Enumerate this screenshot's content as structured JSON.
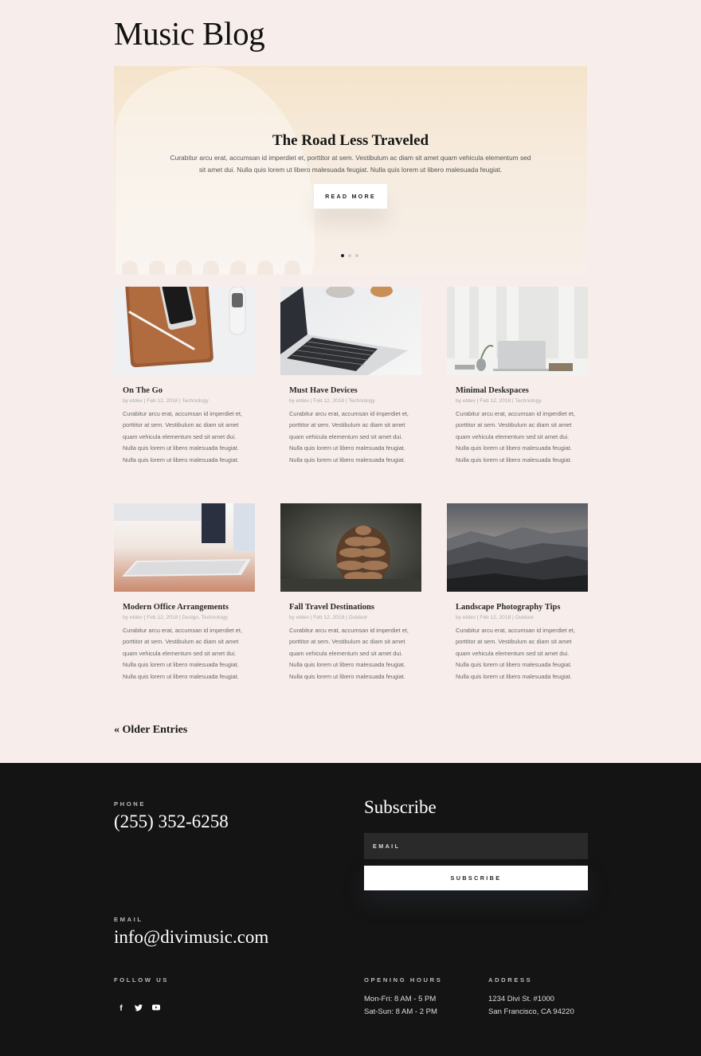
{
  "page": {
    "title": "Music Blog"
  },
  "hero": {
    "title": "The Road Less Traveled",
    "text": "Curabitur arcu erat, accumsan id imperdiet et, porttitor at sem. Vestibulum ac diam sit amet quam vehicula elementum sed sit amet dui. Nulla quis lorem ut libero malesuada feugiat. Nulla quis lorem ut libero malesuada feugiat.",
    "button_label": "READ MORE",
    "slides": 3,
    "active_slide": 1
  },
  "posts": [
    {
      "title": "On The Go",
      "meta": "by etdev | Feb 12, 2018 | Technology",
      "excerpt": "Curabitur arcu erat, accumsan id imperdiet et, porttitor at sem. Vestibulum ac diam sit amet quam vehicula elementum sed sit amet dui. Nulla quis lorem ut libero malesuada feugiat. Nulla quis lorem ut libero malesuada feugiat.",
      "image": "tablet-phone-pen"
    },
    {
      "title": "Must Have Devices",
      "meta": "by etdev | Feb 12, 2018 | Technology",
      "excerpt": "Curabitur arcu erat, accumsan id imperdiet et, porttitor at sem. Vestibulum ac diam sit amet quam vehicula elementum sed sit amet dui. Nulla quis lorem ut libero malesuada feugiat. Nulla quis lorem ut libero malesuada feugiat.",
      "image": "laptop-keyboard"
    },
    {
      "title": "Minimal Deskspaces",
      "meta": "by etdev | Feb 12, 2018 | Technology",
      "excerpt": "Curabitur arcu erat, accumsan id imperdiet et, porttitor at sem. Vestibulum ac diam sit amet quam vehicula elementum sed sit amet dui. Nulla quis lorem ut libero malesuada feugiat. Nulla quis lorem ut libero malesuada feugiat.",
      "image": "desk-laptop"
    },
    {
      "title": "Modern Office Arrangements",
      "meta": "by etdev | Feb 12, 2018 | Design, Technology",
      "excerpt": "Curabitur arcu erat, accumsan id imperdiet et, porttitor at sem. Vestibulum ac diam sit amet quam vehicula elementum sed sit amet dui. Nulla quis lorem ut libero malesuada feugiat. Nulla quis lorem ut libero malesuada feugiat.",
      "image": "keyboard"
    },
    {
      "title": "Fall Travel Destinations",
      "meta": "by etdev | Feb 12, 2018 | Outdoor",
      "excerpt": "Curabitur arcu erat, accumsan id imperdiet et, porttitor at sem. Vestibulum ac diam sit amet quam vehicula elementum sed sit amet dui. Nulla quis lorem ut libero malesuada feugiat. Nulla quis lorem ut libero malesuada feugiat.",
      "image": "pinecone"
    },
    {
      "title": "Landscape Photography Tips",
      "meta": "by etdev | Feb 12, 2018 | Outdoor",
      "excerpt": "Curabitur arcu erat, accumsan id imperdiet et, porttitor at sem. Vestibulum ac diam sit amet quam vehicula elementum sed sit amet dui. Nulla quis lorem ut libero malesuada feugiat. Nulla quis lorem ut libero malesuada feugiat.",
      "image": "mountains"
    }
  ],
  "pagination": {
    "older_label": "« Older Entries"
  },
  "footer": {
    "phone_label": "PHONE",
    "phone": "(255) 352-6258",
    "email_label": "EMAIL",
    "email": "info@divimusic.com",
    "follow_label": "FOLLOW US",
    "social": [
      "facebook",
      "twitter",
      "youtube"
    ],
    "subscribe": {
      "title": "Subscribe",
      "email_placeholder": "EMAIL",
      "button_label": "SUBSCRIBE"
    },
    "hours": {
      "label": "OPENING HOURS",
      "lines": [
        "Mon-Fri: 8 AM - 5 PM",
        "Sat-Sun: 8 AM - 2 PM"
      ]
    },
    "address": {
      "label": "ADDRESS",
      "lines": [
        "1234 Divi St. #1000",
        "San Francisco, CA 94220"
      ]
    }
  }
}
